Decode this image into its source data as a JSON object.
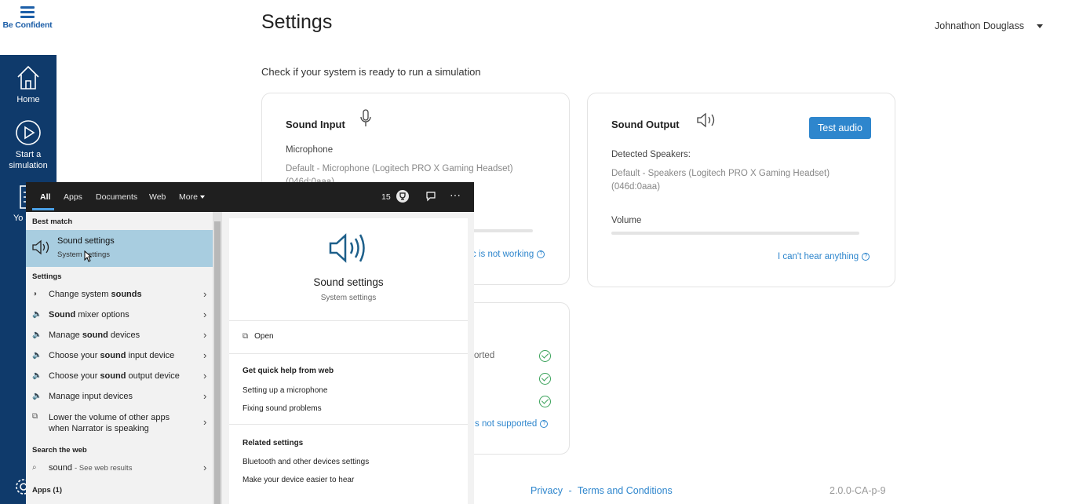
{
  "app": {
    "logo_text": "Be Confident",
    "page_title": "Settings",
    "user_name": "Johnathon Douglass",
    "subtitle": "Check if your system is ready to run a simulation"
  },
  "sidebar": {
    "items": [
      {
        "label": "Home",
        "icon": "home-icon"
      },
      {
        "label": "Start a simulation",
        "icon": "play-icon"
      },
      {
        "label": "Yo sess",
        "icon": "list-icon"
      }
    ]
  },
  "sound_input": {
    "title": "Sound Input",
    "mic_label": "Microphone",
    "device_line1": "Default - Microphone (Logitech PRO X Gaming Headset)",
    "device_line2": "(046d:0aaa)",
    "help_text": "c is not working"
  },
  "sound_output": {
    "title": "Sound Output",
    "test_button": "Test audio",
    "detected_label": "Detected Speakers:",
    "device_line1": "Default - Speakers (Logitech PRO X Gaming Headset)",
    "device_line2": "(046d:0aaa)",
    "volume_label": "Volume",
    "help_text": "I can't hear anything"
  },
  "compat_card": {
    "row1_text": "orted",
    "help_text": "s not supported"
  },
  "footer": {
    "privacy": "Privacy",
    "separator": "-",
    "terms": "Terms and Conditions",
    "version": "2.0.0-CA-p-9"
  },
  "search": {
    "tabs": [
      "All",
      "Apps",
      "Documents",
      "Web",
      "More"
    ],
    "points": "15",
    "best_match_header": "Best match",
    "best_match": {
      "title": "Sound settings",
      "subtitle": "System settings"
    },
    "settings_header": "Settings",
    "settings_items": [
      {
        "pre": "Change system ",
        "bold": "sounds",
        "post": ""
      },
      {
        "pre": "",
        "bold": "Sound",
        "post": " mixer options"
      },
      {
        "pre": "Manage ",
        "bold": "sound",
        "post": " devices"
      },
      {
        "pre": "Choose your ",
        "bold": "sound",
        "post": " input device"
      },
      {
        "pre": "Choose your ",
        "bold": "sound",
        "post": " output device"
      },
      {
        "pre": "Manage input devices",
        "bold": "",
        "post": ""
      }
    ],
    "narrator_item_line1": "Lower the volume of other apps",
    "narrator_item_line2": "when Narrator is speaking",
    "web_header": "Search the web",
    "web_query": "sound",
    "web_suffix": "- See web results",
    "apps_header": "Apps (1)",
    "preview": {
      "title": "Sound settings",
      "subtitle": "System settings",
      "open": "Open",
      "quick_help_header": "Get quick help from web",
      "quick_help": [
        "Setting up a microphone",
        "Fixing sound problems"
      ],
      "related_header": "Related settings",
      "related": [
        "Bluetooth and other devices settings",
        "Make your device easier to hear"
      ]
    }
  },
  "colors": {
    "sidebar": "#0f3a6b",
    "accent": "#2e86cd",
    "best_match": "#a8cde0",
    "search_bar": "#1f1f1f",
    "check": "#3aa25a"
  }
}
